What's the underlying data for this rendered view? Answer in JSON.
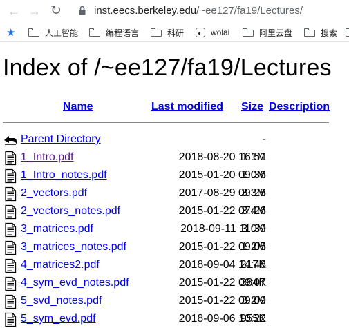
{
  "browser": {
    "back_icon": "arrow-left",
    "forward_icon": "arrow-right",
    "reload_icon": "reload",
    "url_host": "inst.eecs.berkeley.edu",
    "url_path": "/~ee127/fa19/Lectures/"
  },
  "bookmarks": [
    {
      "label": "人工智能"
    },
    {
      "label": "编程语言"
    },
    {
      "label": "科研"
    },
    {
      "label": "wolai"
    },
    {
      "label": "阿里云盘"
    },
    {
      "label": "搜索"
    }
  ],
  "page": {
    "title": "Index of /~ee127/fa19/Lectures",
    "columns": {
      "name": "Name",
      "modified": "Last modified",
      "size": "Size",
      "description": "Description"
    },
    "parent": {
      "label": "Parent Directory",
      "size": "-"
    },
    "files": [
      {
        "name": "1_Intro.pdf",
        "modified": "2018-08-20 16:51",
        "size": "1.1M",
        "visited": true
      },
      {
        "name": "1_Intro_notes.pdf",
        "modified": "2015-01-20 09:36",
        "size": "1.0M",
        "visited": false
      },
      {
        "name": "2_vectors.pdf",
        "modified": "2017-08-29 09:28",
        "size": "3.3M",
        "visited": false
      },
      {
        "name": "2_vectors_notes.pdf",
        "modified": "2015-01-22 07:26",
        "size": "3.4M",
        "visited": false
      },
      {
        "name": "3_matrices.pdf",
        "modified": "2018-09-11 11:39",
        "size": "3.0M",
        "visited": false
      },
      {
        "name": "3_matrices_notes.pdf",
        "modified": "2015-01-22 09:05",
        "size": "1.2M",
        "visited": false
      },
      {
        "name": "4_matrices2.pdf",
        "modified": "2018-09-04 14:48",
        "size": "217K",
        "visited": false
      },
      {
        "name": "4_sym_evd_notes.pdf",
        "modified": "2015-01-22 09:07",
        "size": "384K",
        "visited": false
      },
      {
        "name": "5_svd_notes.pdf",
        "modified": "2015-01-22 09:09",
        "size": "3.2M",
        "visited": false
      },
      {
        "name": "5_sym_evd.pdf",
        "modified": "2018-09-06 10:22",
        "size": "955K",
        "visited": false
      }
    ]
  }
}
